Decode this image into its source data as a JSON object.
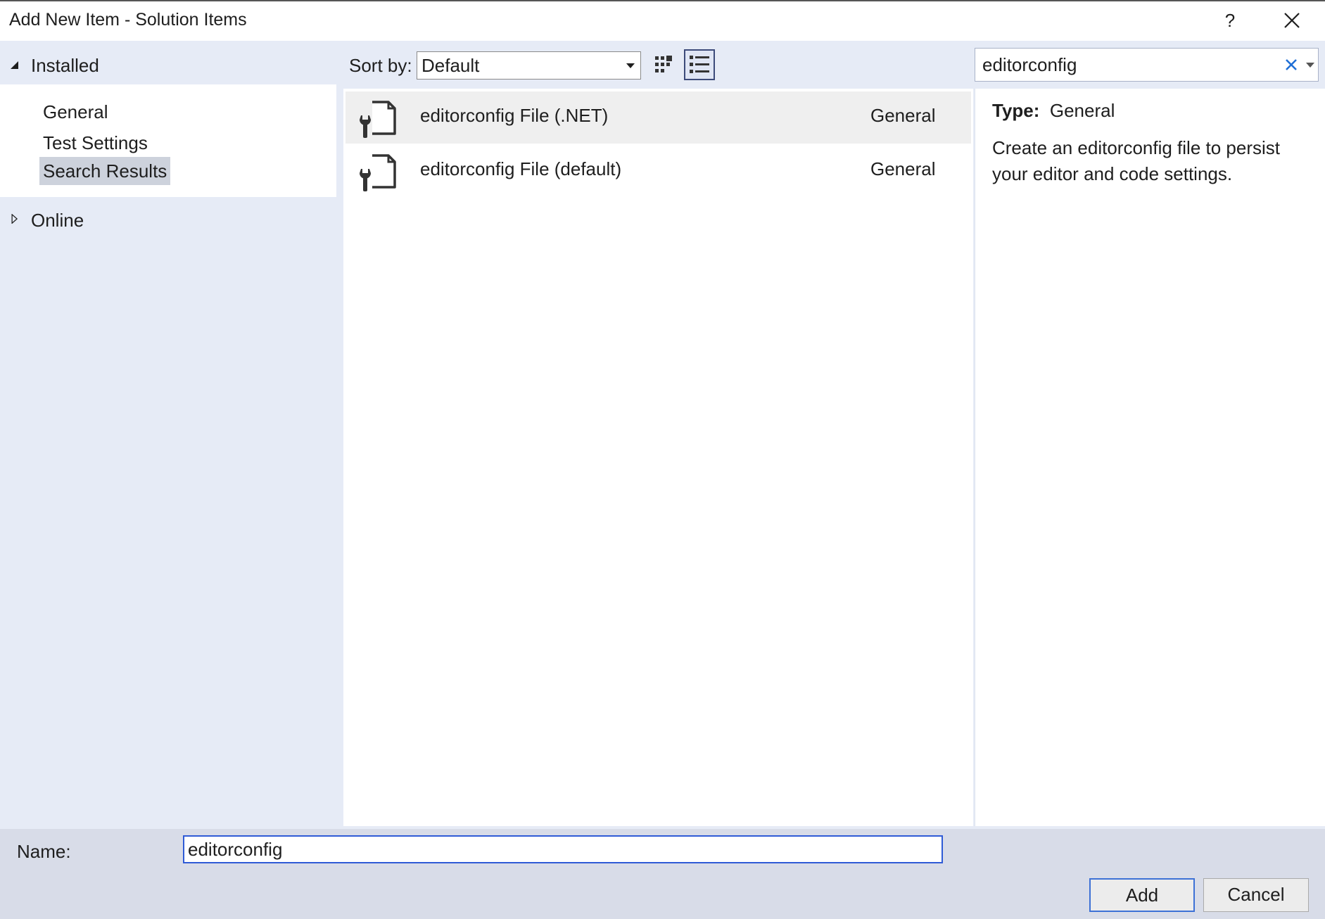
{
  "window": {
    "title": "Add New Item - Solution Items",
    "help_label": "?"
  },
  "tree": {
    "installed_label": "Installed",
    "items": [
      {
        "label": "General"
      },
      {
        "label": "Test Settings"
      },
      {
        "label": "Search Results",
        "selected": true
      }
    ],
    "online_label": "Online"
  },
  "toolbar": {
    "sort_label": "Sort by:",
    "sort_value": "Default",
    "search_value": "editorconfig"
  },
  "templates": [
    {
      "name": "editorconfig File (.NET)",
      "category": "General",
      "selected": true
    },
    {
      "name": "editorconfig File (default)",
      "category": "General",
      "selected": false
    }
  ],
  "details": {
    "type_key": "Type:",
    "type_value": "General",
    "description": "Create an editorconfig file to persist your editor and code settings."
  },
  "footer": {
    "name_label": "Name:",
    "name_value": "editorconfig",
    "add_label": "Add",
    "cancel_label": "Cancel"
  },
  "colors": {
    "background": "#e6ebf6",
    "selected_item": "#cdd2dc",
    "focus_border": "#2f5bd6",
    "clear_icon": "#1f6fd6"
  }
}
